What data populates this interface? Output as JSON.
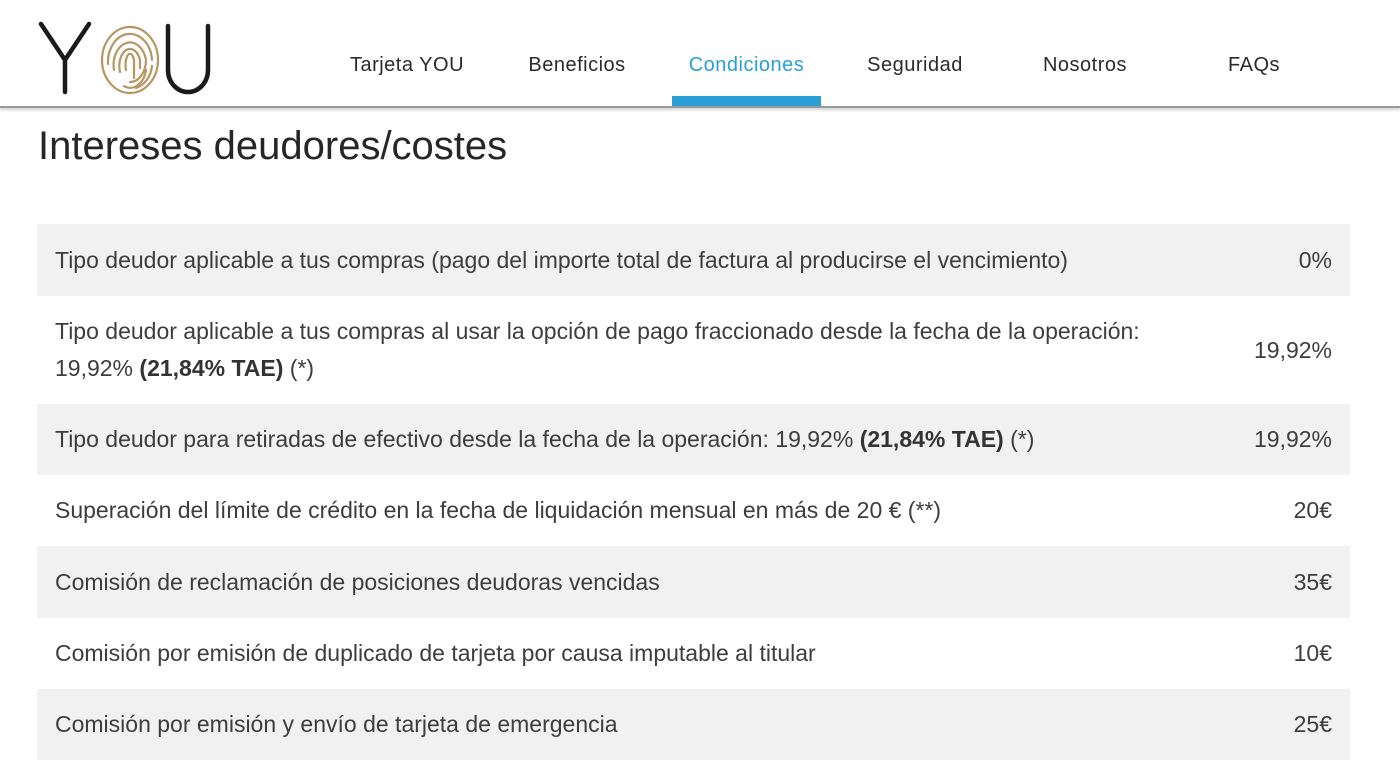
{
  "brand": {
    "name": "YOU",
    "accent_color": "#2a9fd6",
    "logo_icon": "fingerprint-icon"
  },
  "nav": {
    "items": [
      {
        "label": "Tarjeta YOU",
        "active": false
      },
      {
        "label": "Beneficios",
        "active": false
      },
      {
        "label": "Condiciones",
        "active": true
      },
      {
        "label": "Seguridad",
        "active": false
      },
      {
        "label": "Nosotros",
        "active": false
      },
      {
        "label": "FAQs",
        "active": false
      }
    ]
  },
  "page": {
    "title": "Intereses deudores/costes"
  },
  "fees": [
    {
      "desc": "Tipo deudor aplicable a tus compras (pago del importe total de factura al producirse el vencimiento)",
      "bold": "",
      "suffix": "",
      "value": "0%"
    },
    {
      "desc": "Tipo deudor aplicable a tus compras al usar la opción de pago fraccionado desde la fecha de la operación: 19,92% ",
      "bold": "(21,84% TAE)",
      "suffix": " (*)",
      "value": "19,92%"
    },
    {
      "desc": "Tipo deudor para retiradas de efectivo desde la fecha de la operación: 19,92% ",
      "bold": "(21,84% TAE)",
      "suffix": " (*)",
      "value": "19,92%"
    },
    {
      "desc": "Superación del límite de crédito en la fecha de liquidación mensual en más de 20 € (**)",
      "bold": "",
      "suffix": "",
      "value": "20€"
    },
    {
      "desc": "Comisión de reclamación de posiciones deudoras vencidas",
      "bold": "",
      "suffix": "",
      "value": "35€"
    },
    {
      "desc": "Comisión por emisión de duplicado de tarjeta por causa imputable al titular",
      "bold": "",
      "suffix": "",
      "value": "10€"
    },
    {
      "desc": "Comisión por emisión y envío de tarjeta de emergencia",
      "bold": "",
      "suffix": "",
      "value": "25€"
    }
  ]
}
